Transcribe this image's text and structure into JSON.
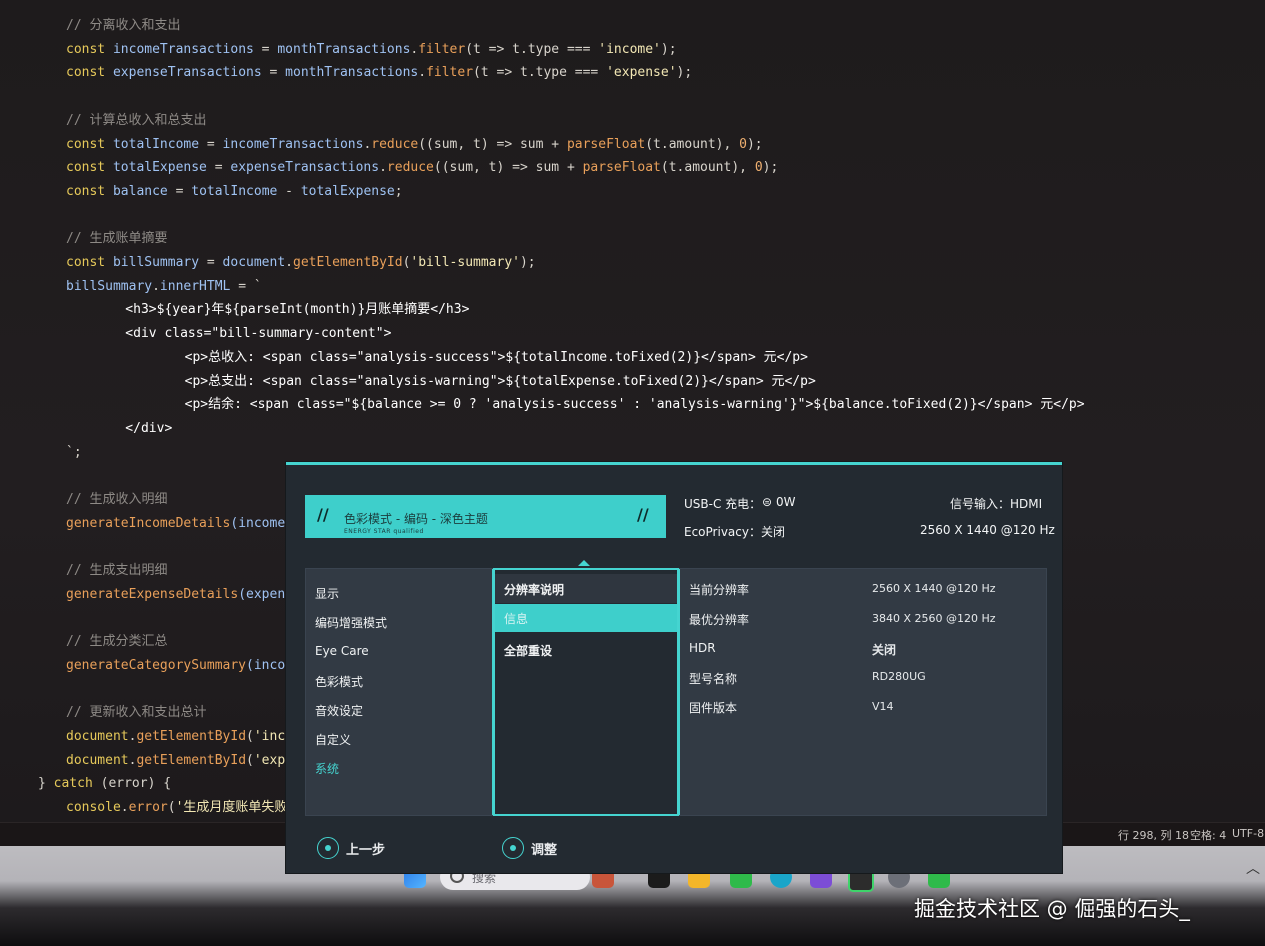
{
  "editor": {
    "lines": [
      [
        {
          "t": "// 分离收入和支出",
          "c": "comment"
        }
      ],
      [
        {
          "t": "const ",
          "c": "keyword"
        },
        {
          "t": "incomeTransactions",
          "c": "var"
        },
        {
          "t": " = ",
          "c": "op"
        },
        {
          "t": "monthTransactions",
          "c": "var"
        },
        {
          "t": ".",
          "c": "op"
        },
        {
          "t": "filter",
          "c": "fn"
        },
        {
          "t": "(t => t.type === ",
          "c": "op"
        },
        {
          "t": "'income'",
          "c": "str"
        },
        {
          "t": ");",
          "c": "op"
        }
      ],
      [
        {
          "t": "const ",
          "c": "keyword"
        },
        {
          "t": "expenseTransactions",
          "c": "var"
        },
        {
          "t": " = ",
          "c": "op"
        },
        {
          "t": "monthTransactions",
          "c": "var"
        },
        {
          "t": ".",
          "c": "op"
        },
        {
          "t": "filter",
          "c": "fn"
        },
        {
          "t": "(t => t.type === ",
          "c": "op"
        },
        {
          "t": "'expense'",
          "c": "str"
        },
        {
          "t": ");",
          "c": "op"
        }
      ],
      [],
      [
        {
          "t": "// 计算总收入和总支出",
          "c": "comment"
        }
      ],
      [
        {
          "t": "const ",
          "c": "keyword"
        },
        {
          "t": "totalIncome",
          "c": "var"
        },
        {
          "t": " = ",
          "c": "op"
        },
        {
          "t": "incomeTransactions",
          "c": "var"
        },
        {
          "t": ".",
          "c": "op"
        },
        {
          "t": "reduce",
          "c": "fn"
        },
        {
          "t": "((sum, t) => sum + ",
          "c": "op"
        },
        {
          "t": "parseFloat",
          "c": "fn"
        },
        {
          "t": "(t.amount), ",
          "c": "op"
        },
        {
          "t": "0",
          "c": "num"
        },
        {
          "t": ");",
          "c": "op"
        }
      ],
      [
        {
          "t": "const ",
          "c": "keyword"
        },
        {
          "t": "totalExpense",
          "c": "var"
        },
        {
          "t": " = ",
          "c": "op"
        },
        {
          "t": "expenseTransactions",
          "c": "var"
        },
        {
          "t": ".",
          "c": "op"
        },
        {
          "t": "reduce",
          "c": "fn"
        },
        {
          "t": "((sum, t) => sum + ",
          "c": "op"
        },
        {
          "t": "parseFloat",
          "c": "fn"
        },
        {
          "t": "(t.amount), ",
          "c": "op"
        },
        {
          "t": "0",
          "c": "num"
        },
        {
          "t": ");",
          "c": "op"
        }
      ],
      [
        {
          "t": "const ",
          "c": "keyword"
        },
        {
          "t": "balance",
          "c": "var"
        },
        {
          "t": " = ",
          "c": "op"
        },
        {
          "t": "totalIncome",
          "c": "var"
        },
        {
          "t": " - ",
          "c": "op"
        },
        {
          "t": "totalExpense",
          "c": "var"
        },
        {
          "t": ";",
          "c": "op"
        }
      ],
      [],
      [
        {
          "t": "// 生成账单摘要",
          "c": "comment"
        }
      ],
      [
        {
          "t": "const ",
          "c": "keyword"
        },
        {
          "t": "billSummary",
          "c": "var"
        },
        {
          "t": " = ",
          "c": "op"
        },
        {
          "t": "document",
          "c": "var"
        },
        {
          "t": ".",
          "c": "op"
        },
        {
          "t": "getElementById",
          "c": "fn"
        },
        {
          "t": "(",
          "c": "op"
        },
        {
          "t": "'bill-summary'",
          "c": "str"
        },
        {
          "t": ");",
          "c": "op"
        }
      ],
      [
        {
          "t": "billSummary",
          "c": "var"
        },
        {
          "t": ".",
          "c": "op"
        },
        {
          "t": "innerHTML",
          "c": "var"
        },
        {
          "t": " = `",
          "c": "op"
        }
      ],
      [
        {
          "t": "    <h3>${year}年${parseInt(month)}月账单摘要</h3>",
          "c": "tag"
        }
      ],
      [
        {
          "t": "    <div class=\"bill-summary-content\">",
          "c": "tag"
        }
      ],
      [
        {
          "t": "        <p>总收入: <span class=\"analysis-success\">${totalIncome.toFixed(2)}</span> 元</p>",
          "c": "tag"
        }
      ],
      [
        {
          "t": "        <p>总支出: <span class=\"analysis-warning\">${totalExpense.toFixed(2)}</span> 元</p>",
          "c": "tag"
        }
      ],
      [
        {
          "t": "        <p>结余: <span class=\"${balance >= 0 ? 'analysis-success' : 'analysis-warning'}\">${balance.toFixed(2)}</span> 元</p>",
          "c": "tag"
        }
      ],
      [
        {
          "t": "    </div>",
          "c": "tag"
        }
      ],
      [
        {
          "t": "`;",
          "c": "op"
        }
      ],
      [],
      [
        {
          "t": "// 生成收入明细",
          "c": "comment"
        }
      ],
      [
        {
          "t": "generateIncomeDetails",
          "c": "fn"
        },
        {
          "t": "(incomeTra",
          "c": "var"
        }
      ],
      [],
      [
        {
          "t": "// 生成支出明细",
          "c": "comment"
        }
      ],
      [
        {
          "t": "generateExpenseDetails",
          "c": "fn"
        },
        {
          "t": "(expenseT",
          "c": "var"
        }
      ],
      [],
      [
        {
          "t": "// 生成分类汇总",
          "c": "comment"
        }
      ],
      [
        {
          "t": "generateCategorySummary",
          "c": "fn"
        },
        {
          "t": "(incomeT",
          "c": "var"
        }
      ],
      [],
      [
        {
          "t": "// 更新收入和支出总计",
          "c": "comment"
        }
      ],
      [
        {
          "t": "document",
          "c": "keyword"
        },
        {
          "t": ".",
          "c": "op"
        },
        {
          "t": "getElementById",
          "c": "fn"
        },
        {
          "t": "(",
          "c": "op"
        },
        {
          "t": "'income",
          "c": "str"
        }
      ],
      [
        {
          "t": "document",
          "c": "keyword"
        },
        {
          "t": ".",
          "c": "op"
        },
        {
          "t": "getElementById",
          "c": "fn"
        },
        {
          "t": "(",
          "c": "op"
        },
        {
          "t": "'expens",
          "c": "str"
        }
      ],
      [
        {
          "t": "} ",
          "c": "op"
        },
        {
          "t": "catch",
          "c": "keyword"
        },
        {
          "t": " (error) {",
          "c": "op"
        }
      ],
      [
        {
          "t": "console",
          "c": "keyword"
        },
        {
          "t": ".",
          "c": "op"
        },
        {
          "t": "error",
          "c": "fn"
        },
        {
          "t": "(",
          "c": "op"
        },
        {
          "t": "'生成月度账单失败:',",
          "c": "str"
        }
      ]
    ],
    "indents": [
      66,
      66,
      66,
      0,
      66,
      66,
      66,
      66,
      0,
      66,
      66,
      66,
      94,
      94,
      122,
      122,
      122,
      94,
      66,
      0,
      66,
      66,
      0,
      66,
      66,
      0,
      66,
      66,
      0,
      66,
      66,
      66,
      38,
      66
    ],
    "colors": {
      "comment": "#8e8a86",
      "keyword": "#e6c95a",
      "var": "#9fc2f2",
      "fn": "#e9a05a",
      "str": "#f2e7b4",
      "op": "#d8d4cc",
      "tag": "#ffffff",
      "num": "#f0b070"
    }
  },
  "statusbar": {
    "position": "行 298, 列 18",
    "spaces": "空格: 4",
    "encoding": "UTF-8"
  },
  "taskbar": {
    "search_placeholder": "搜索",
    "icons": [
      "windows-start-icon",
      "search-icon",
      "user-avatar-icon",
      "terminal-icon",
      "file-explorer-icon",
      "wechat-icon",
      "edge-icon",
      "obsidian-icon",
      "green-app-icon",
      "settings-icon",
      "wechat-work-icon"
    ]
  },
  "watermark": "掘金技术社区 @ 倔强的石头_",
  "osd": {
    "mode_title": "色彩模式 - 编码 - 深色主题",
    "mode_sub": "ENERGY STAR qualified",
    "usbc_label": "USB-C 充电：",
    "usbc_value": "0W",
    "ecoprivacy": "EcoPrivacy：关闭",
    "signal_input": "信号输入：HDMI",
    "signal_res": "2560 X 1440 @120 Hz",
    "menu": [
      "显示",
      "编码增强模式",
      "Eye Care",
      "色彩模式",
      "音效设定",
      "自定义",
      "系统"
    ],
    "submenu": [
      "分辨率说明",
      "信息",
      "全部重设"
    ],
    "info_labels": [
      "当前分辨率",
      "最优分辨率",
      "HDR",
      "型号名称",
      "固件版本"
    ],
    "info_values": [
      "2560 X 1440 @120 Hz",
      "3840 X 2560 @120 Hz",
      "关闭",
      "RD280UG",
      "V14"
    ],
    "footer_back": "上一步",
    "footer_adjust": "调整",
    "accent_color": "#3ecfcb"
  }
}
